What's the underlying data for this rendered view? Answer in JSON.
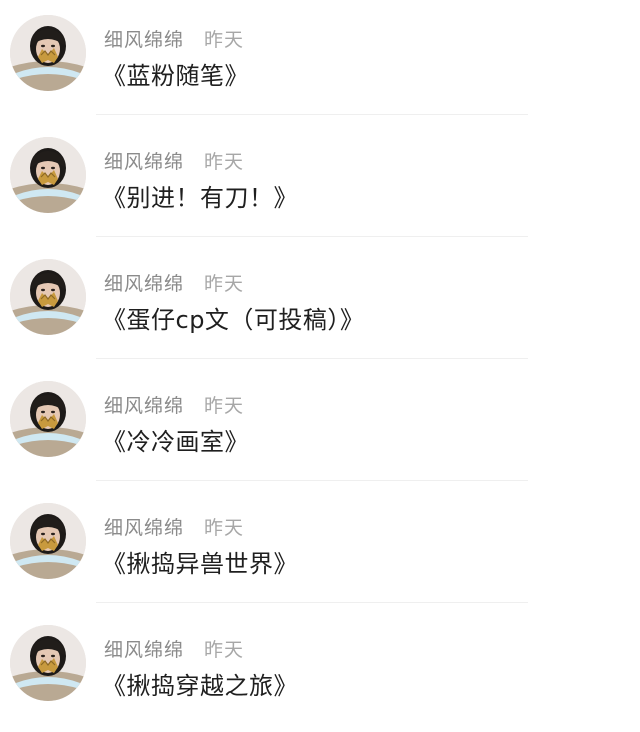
{
  "messages": [
    {
      "user": "细风绵绵",
      "time": "昨天",
      "title": "《蓝粉随笔》",
      "avatar_icon": "user-avatar-image"
    },
    {
      "user": "细风绵绵",
      "time": "昨天",
      "title": "《别进！有刀！》",
      "avatar_icon": "user-avatar-image"
    },
    {
      "user": "细风绵绵",
      "time": "昨天",
      "title": "《蛋仔cp文（可投稿）》",
      "avatar_icon": "user-avatar-image"
    },
    {
      "user": "细风绵绵",
      "time": "昨天",
      "title": "《冷冷画室》",
      "avatar_icon": "user-avatar-image"
    },
    {
      "user": "细风绵绵",
      "time": "昨天",
      "title": "《揪捣异兽世界》",
      "avatar_icon": "user-avatar-image"
    },
    {
      "user": "细风绵绵",
      "time": "昨天",
      "title": "《揪捣穿越之旅》",
      "avatar_icon": "user-avatar-image"
    }
  ],
  "colors": {
    "username": "#8b8b8b",
    "time": "#a7a7a7",
    "title": "#1f1f1f",
    "divider": "#efefef"
  }
}
